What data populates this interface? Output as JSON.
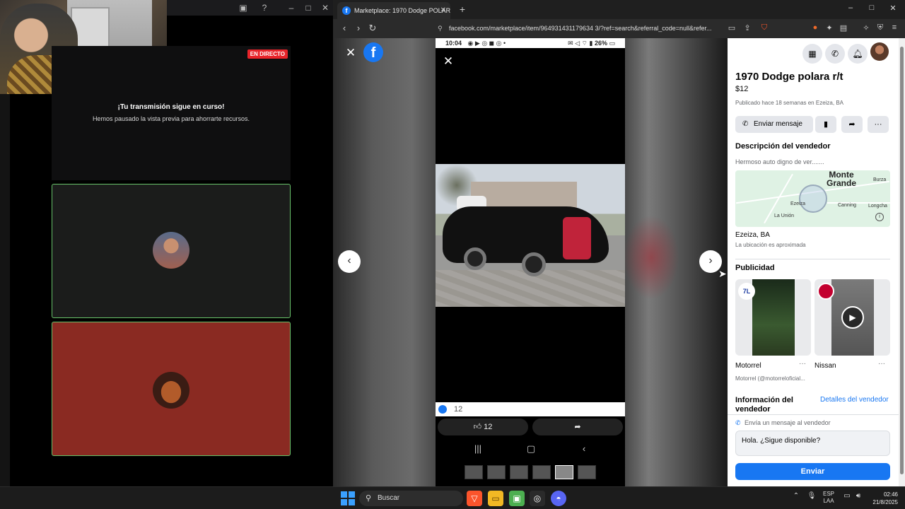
{
  "stream_app": {
    "live_badge": "EN DIRECTO",
    "paused_title": "¡Tu transmisión sigue en curso!",
    "paused_subtitle": "Hemos pausado la vista previa para ahorrarte recursos.",
    "tile_border_color": "#68c26a",
    "tile2_bg_color": "#8a2a22"
  },
  "browser": {
    "tab_title": "Marketplace: 1970 Dodge POLAR",
    "url": "facebook.com/marketplace/item/964931431179634 3/?ref=search&referral_code=null&refer...",
    "viewer": {
      "phone_time": "10:04",
      "phone_battery": "26%",
      "likes_count": "12",
      "like_button_count": "12"
    },
    "listing": {
      "title": "1970 Dodge polara r/t",
      "price": "$12",
      "posted": "Publicado hace 18 semanas en Ezeiza, BA",
      "send_message_label": "Enviar mensaje",
      "description_header": "Descripción del vendedor",
      "description": "Hermoso auto digno de ver.......",
      "map_labels": {
        "monte_grande": "Monte Grande",
        "burzaco": "Burza",
        "ezeiza": "Ezeiza",
        "canning": "Canning",
        "la_union": "La Unión",
        "longchamps": "Longcha"
      },
      "location": "Ezeiza, BA",
      "location_sub": "La ubicación es aproximada",
      "ads_header": "Publicidad",
      "ads": [
        {
          "name": "Motorrel",
          "sub": "Motorrel (@motorreloficial..."
        },
        {
          "name": "Nissan",
          "sub": ""
        }
      ],
      "seller_info_header": "Información del vendedor",
      "seller_details_link": "Detalles del vendedor",
      "send_label": "Envía un mensaje al vendedor",
      "message_value": "Hola. ¿Sigue disponible?",
      "send_button": "Enviar"
    }
  },
  "taskbar": {
    "search_label": "Buscar",
    "lang_top": "ESP",
    "lang_bottom": "LAA",
    "time": "02:46",
    "date": "21/8/2025"
  },
  "colors": {
    "facebook_blue": "#1877f2",
    "live_red": "#e8242a"
  }
}
